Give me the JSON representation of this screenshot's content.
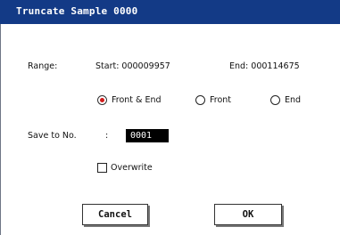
{
  "dialog": {
    "title": "Truncate Sample 0000"
  },
  "range": {
    "label": "Range:",
    "start_label": "Start: 000009957",
    "end_label": "End: 000114675"
  },
  "mode": {
    "options": [
      {
        "label": "Front & End",
        "selected": true
      },
      {
        "label": "Front",
        "selected": false
      },
      {
        "label": "End",
        "selected": false
      }
    ]
  },
  "save_to": {
    "label": "Save to No.",
    "separator": ":",
    "value": "0001"
  },
  "overwrite": {
    "label": "Overwrite",
    "checked": false
  },
  "buttons": {
    "cancel": "Cancel",
    "ok": "OK"
  },
  "colors": {
    "titlebar": "#133a86",
    "radio_selected": "#d11a1a"
  }
}
